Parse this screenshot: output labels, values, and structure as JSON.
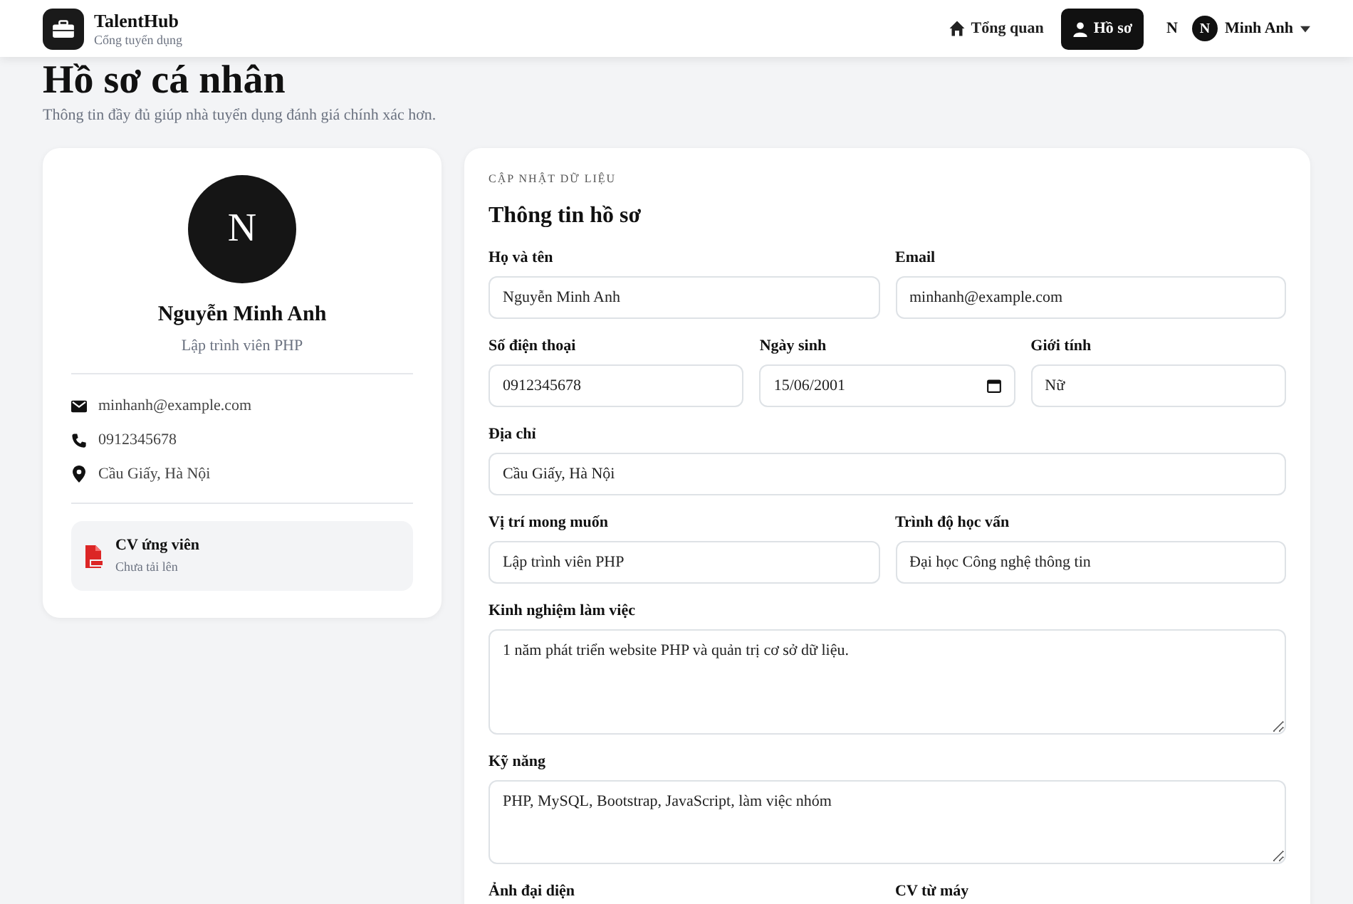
{
  "header": {
    "brand": "TalentHub",
    "tagline": "Cổng tuyển dụng",
    "nav": [
      {
        "label": "Tổng quan",
        "kind": "home",
        "selected": false
      },
      {
        "label": "Hồ sơ",
        "kind": "user",
        "selected": true
      }
    ],
    "user": {
      "initial_text": "N",
      "avatar_initial": "N",
      "name": "Minh Anh"
    }
  },
  "page": {
    "title": "Hồ sơ cá nhân",
    "subtitle": "Thông tin đầy đủ giúp nhà tuyển dụng đánh giá chính xác hơn."
  },
  "profile_card": {
    "avatar_initial": "N",
    "name": "Nguyễn Minh Anh",
    "role": "Lập trình viên PHP",
    "contacts": [
      {
        "kind": "email",
        "text": "minhanh@example.com"
      },
      {
        "kind": "phone",
        "text": "0912345678"
      },
      {
        "kind": "location",
        "text": "Cầu Giấy, Hà Nội"
      }
    ],
    "cv": {
      "title": "CV ứng viên",
      "status": "Chưa tải lên"
    }
  },
  "form": {
    "eyebrow": "CẬP NHẬT DỮ LIỆU",
    "title": "Thông tin hồ sơ",
    "rows": [
      [
        {
          "kind": "input",
          "label": "Họ và tên",
          "value": "Nguyễn Minh Anh"
        },
        {
          "kind": "input",
          "label": "Email",
          "value": "minhanh@example.com"
        }
      ],
      [
        {
          "kind": "input",
          "label": "Số điện thoại",
          "value": "0912345678"
        },
        {
          "kind": "date",
          "label": "Ngày sinh",
          "value": "15/06/2001"
        },
        {
          "kind": "input",
          "label": "Giới tính",
          "value": "Nữ"
        }
      ],
      [
        {
          "kind": "input",
          "label": "Địa chỉ",
          "value": "Cầu Giấy, Hà Nội"
        }
      ],
      [
        {
          "kind": "input",
          "label": "Vị trí mong muốn",
          "value": "Lập trình viên PHP"
        },
        {
          "kind": "input",
          "label": "Trình độ học vấn",
          "value": "Đại học Công nghệ thông tin"
        }
      ],
      [
        {
          "kind": "textarea",
          "label": "Kinh nghiệm làm việc",
          "value": "1 năm phát triển website PHP và quản trị cơ sở dữ liệu."
        }
      ],
      [
        {
          "kind": "textarea_short",
          "label": "Kỹ năng",
          "value": "PHP, MySQL, Bootstrap, JavaScript, làm việc nhóm"
        }
      ],
      [
        {
          "kind": "label_only",
          "label": "Ảnh đại diện"
        },
        {
          "kind": "label_only",
          "label": "CV từ máy"
        }
      ]
    ]
  }
}
